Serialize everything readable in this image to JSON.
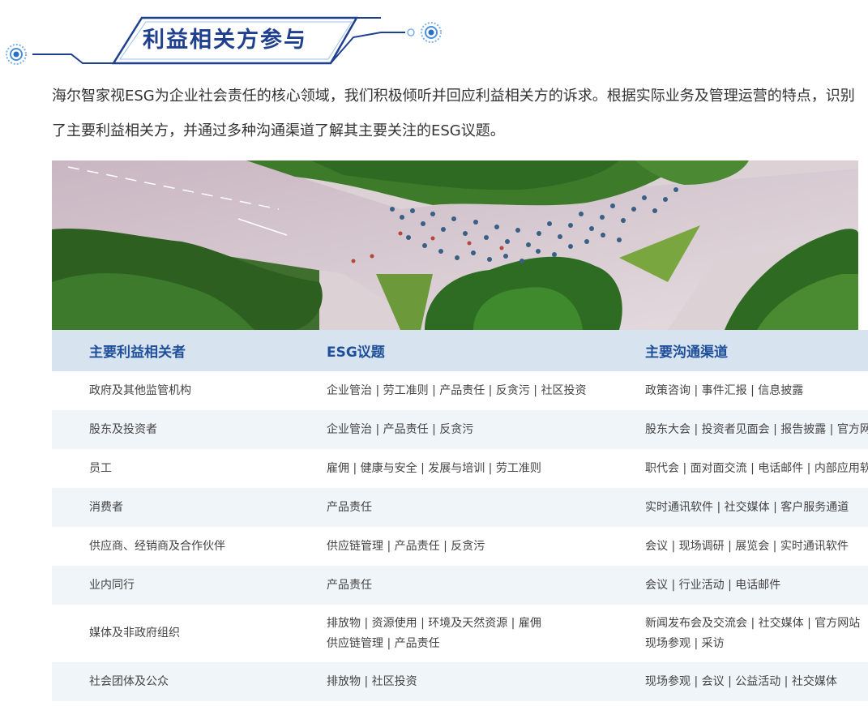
{
  "header": {
    "title": "利益相关方参与",
    "accent_color": "#1f3f8f",
    "deco_color": "#4a90d9"
  },
  "intro": "海尔智家视ESG为企业社会责任的核心领域，我们积极倾听并回应利益相关方的诉求。根据实际业务及管理运营的特点，识别了主要利益相关方，并通过多种沟通渠道了解其主要关注的ESG议题。",
  "hero": {
    "kind": "aerial-photo-crowd-on-roads"
  },
  "table": {
    "header_bg": "#d7e4ef",
    "stripe_bg": "#f0f5f9",
    "columns": [
      "主要利益相关者",
      "ESG议题",
      "主要沟通渠道"
    ],
    "rows": [
      {
        "stakeholder": "政府及其他监管机构",
        "issues": [
          "企业管治 | 劳工准则 | 产品责任 | 反贪污 | 社区投资"
        ],
        "channels": [
          "政策咨询 | 事件汇报 | 信息披露"
        ]
      },
      {
        "stakeholder": "股东及投资者",
        "issues": [
          "企业管治 | 产品责任 | 反贪污"
        ],
        "channels": [
          "股东大会 | 投资者见面会 | 报告披露 | 官方网站"
        ]
      },
      {
        "stakeholder": "员工",
        "issues": [
          "雇佣 | 健康与安全 | 发展与培训 | 劳工准则"
        ],
        "channels": [
          "职代会 | 面对面交流 | 电话邮件 | 内部应用软件"
        ]
      },
      {
        "stakeholder": "消费者",
        "issues": [
          "产品责任"
        ],
        "channels": [
          "实时通讯软件 | 社交媒体 | 客户服务通道"
        ]
      },
      {
        "stakeholder": "供应商、经销商及合作伙伴",
        "issues": [
          "供应链管理 | 产品责任 | 反贪污"
        ],
        "channels": [
          "会议 | 现场调研 | 展览会 | 实时通讯软件"
        ]
      },
      {
        "stakeholder": "业内同行",
        "issues": [
          "产品责任"
        ],
        "channels": [
          "会议 | 行业活动 | 电话邮件"
        ]
      },
      {
        "stakeholder": "媒体及非政府组织",
        "issues": [
          "排放物 | 资源使用 | 环境及天然资源 | 雇佣",
          "供应链管理 | 产品责任"
        ],
        "channels": [
          "新闻发布会及交流会 | 社交媒体 | 官方网站",
          "现场参观 | 采访"
        ]
      },
      {
        "stakeholder": "社会团体及公众",
        "issues": [
          "排放物 | 社区投资"
        ],
        "channels": [
          "现场参观 | 会议 | 公益活动 | 社交媒体"
        ]
      }
    ]
  }
}
